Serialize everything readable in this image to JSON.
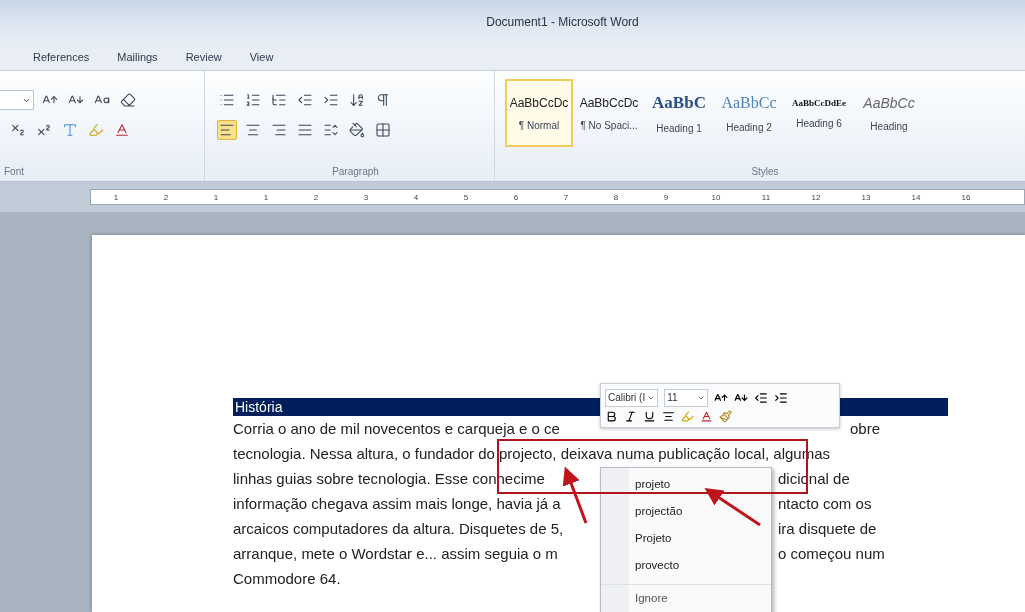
{
  "window": {
    "title": "Document1 - Microsoft Word"
  },
  "ribbon_tabs": [
    "References",
    "Mailings",
    "Review",
    "View"
  ],
  "font_group": {
    "label": "Font",
    "row1": [
      {
        "kind": "size-dropdown"
      },
      {
        "kind": "grow"
      },
      {
        "kind": "shrink"
      },
      {
        "kind": "case"
      },
      {
        "kind": "clear"
      }
    ],
    "row2": [
      {
        "kind": "subscript"
      },
      {
        "kind": "superscript"
      },
      {
        "kind": "effects"
      },
      {
        "kind": "highlight"
      },
      {
        "kind": "font-color"
      }
    ]
  },
  "paragraph_group": {
    "label": "Paragraph",
    "row1": [
      {
        "kind": "bullets"
      },
      {
        "kind": "numbering"
      },
      {
        "kind": "multilevel"
      },
      {
        "kind": "outdent"
      },
      {
        "kind": "indent"
      },
      {
        "kind": "sort"
      },
      {
        "kind": "pilcrow"
      }
    ],
    "row2": [
      {
        "kind": "align-left",
        "selected": true
      },
      {
        "kind": "align-center",
        "selected": false
      },
      {
        "kind": "align-right",
        "selected": false
      },
      {
        "kind": "justify",
        "selected": false
      },
      {
        "kind": "line-spacing"
      },
      {
        "kind": "shading"
      },
      {
        "kind": "borders"
      }
    ]
  },
  "styles_group": {
    "label": "Styles",
    "items": [
      {
        "preview": "AaBbCcDc",
        "name": "¶ Normal",
        "kind": "body",
        "selected": true
      },
      {
        "preview": "AaBbCcDc",
        "name": "¶ No Spaci...",
        "kind": "body",
        "selected": false
      },
      {
        "preview": "AaBbC",
        "name": "Heading 1",
        "kind": "heading1",
        "selected": false
      },
      {
        "preview": "AaBbCc",
        "name": "Heading 2",
        "kind": "heading2",
        "selected": false
      },
      {
        "preview": "AaBbCcDdEe",
        "name": "Heading 6",
        "kind": "small-caps",
        "selected": false
      },
      {
        "preview": "AaBbCc",
        "name": "Heading",
        "kind": "italic",
        "selected": false
      }
    ]
  },
  "ruler": {
    "labels": [
      "1",
      "2",
      "1",
      "1",
      "2",
      "3",
      "4",
      "5",
      "6",
      "7",
      "8",
      "9",
      "10",
      "11",
      "12",
      "13",
      "14",
      "16"
    ]
  },
  "document": {
    "heading": "História",
    "lines": [
      {
        "left": "Corria o ano de mil novecentos e carqueja e o ce",
        "right": "obre"
      },
      {
        "left": "tecnologia. Nessa altura, o fundador do projecto, deixava numa publicação local, algumas"
      },
      {
        "left": "linhas guias sobre tecnologia. Esse conhecime",
        "right": "dicional de"
      },
      {
        "left": "informação chegava assim mais longe, havia já a",
        "right": "ntacto com os"
      },
      {
        "left": "arcaicos computadores da altura. Disquetes de 5,",
        "right": "ira disquete de"
      },
      {
        "left": "arranque, mete o Wordstar e... assim seguia o m",
        "right": "o começou num"
      },
      {
        "left": "Commodore 64."
      }
    ]
  },
  "mini_toolbar": {
    "font": "Calibri (I",
    "size": "11"
  },
  "context_menu": {
    "items": [
      {
        "label": "projeto",
        "kind": "suggestion"
      },
      {
        "label": "projectão",
        "kind": "suggestion"
      },
      {
        "label": "Projeto",
        "kind": "suggestion"
      },
      {
        "label": "provecto",
        "kind": "suggestion"
      },
      {
        "label": "Ignore",
        "kind": "command"
      }
    ]
  }
}
